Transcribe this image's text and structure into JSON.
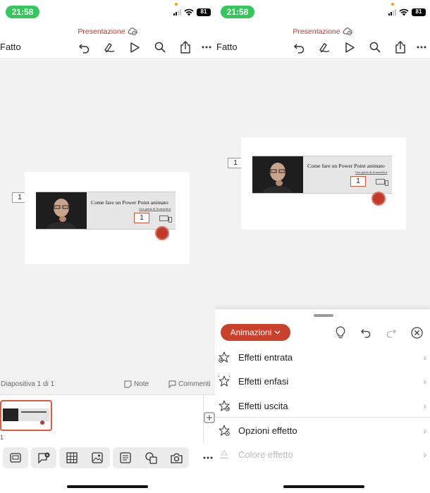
{
  "status": {
    "time": "21:58",
    "battery": "81"
  },
  "header": {
    "title": "Presentazione",
    "done": "Fatto"
  },
  "slide": {
    "number": "1",
    "headline": "Come fare un Power Point animato",
    "subline": "Una guida di Aranzulla.it",
    "field_value": "1"
  },
  "infobar": {
    "count": "Diapositiva 1 di 1",
    "note": "Note",
    "comments": "Commenti"
  },
  "thumbnail": {
    "label": "1"
  },
  "sheet": {
    "dropdown": "Animazioni",
    "items": [
      {
        "label": "Effetti entrata",
        "icon": "star-enter-icon"
      },
      {
        "label": "Effetti enfasi",
        "icon": "star-emphasis-icon"
      },
      {
        "label": "Effetti uscita",
        "icon": "star-exit-icon"
      },
      {
        "label": "Opzioni effetto",
        "icon": "star-options-icon"
      },
      {
        "label": "Colore effetto",
        "icon": "paint-bucket-icon"
      }
    ]
  },
  "colors": {
    "accent": "#c9412b",
    "status_green": "#34c759",
    "canvas": "#f2f2f2"
  }
}
